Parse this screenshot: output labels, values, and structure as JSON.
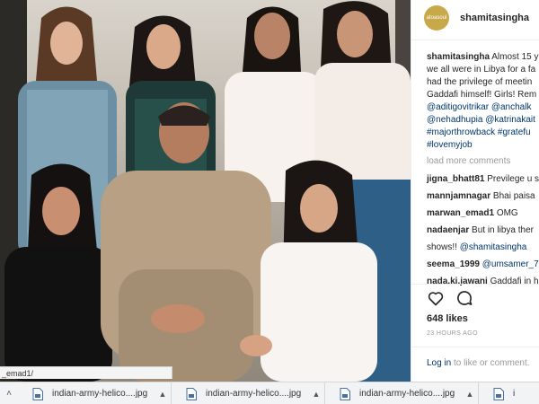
{
  "post": {
    "avatar_text": "atoasoul",
    "username": "shamitasingha",
    "caption": {
      "username": "shamitasingha",
      "line1": "Almost 15 y",
      "line2": "we all were in Libya for a fa",
      "line3": "had the privilege of meetin",
      "line4": "Gaddafi himself! Girls! Rem",
      "tags_line1": "@aditigovitrikar @anchalk",
      "tags_line2": "@nehadhupia @katrinakait",
      "tags_line3": "#majorthrowback #gratefu",
      "tags_line4": "#lovemyjob"
    },
    "load_more": "load more comments",
    "comments": [
      {
        "user": "jigna_bhatt81",
        "text": "Previlege u s"
      },
      {
        "user": "mannjamnagar",
        "text": "Bhai paisa"
      },
      {
        "user": "marwan_emad1",
        "text": "OMG"
      },
      {
        "user": "nadaenjar",
        "text": "But in libya ther"
      },
      {
        "user": "",
        "text": "shows!! ",
        "tag": "@shamitasingha"
      },
      {
        "user": "seema_1999",
        "text": "",
        "tag": "@umsamer_7"
      },
      {
        "user": "nada.ki.jawani",
        "text": "Gaddafi in h"
      }
    ],
    "likes": "648 likes",
    "time": "23 HOURS AGO",
    "login_link": "Log in",
    "login_text": " to like or comment."
  },
  "status_tip": "_emad1/",
  "downloads": {
    "left_chevron": "˄",
    "items": [
      {
        "name": "indian-army-helico....jpg"
      },
      {
        "name": "indian-army-helico....jpg"
      },
      {
        "name": "indian-army-helico....jpg"
      }
    ],
    "last_partial": "i"
  },
  "colors": {
    "link": "#003569",
    "muted": "#999999",
    "text": "#262626",
    "avatar": "#c8a94a"
  },
  "icons": [
    "heart-icon",
    "comment-icon",
    "file-icon",
    "chevron-up-icon",
    "chevron-down-icon"
  ]
}
